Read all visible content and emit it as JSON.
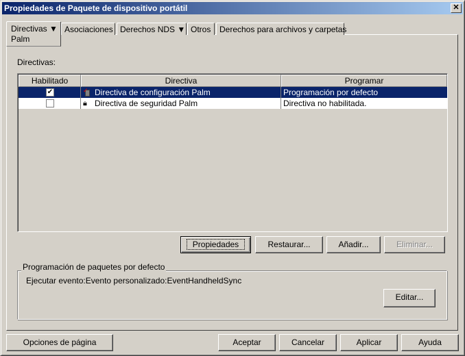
{
  "window": {
    "title": "Propiedades de Paquete de dispositivo portátil",
    "close": "✕"
  },
  "tabs": [
    {
      "label": "Directivas ▼",
      "sub": "Palm"
    },
    {
      "label": "Asociaciones"
    },
    {
      "label": "Derechos NDS ▼"
    },
    {
      "label": "Otros"
    },
    {
      "label": "Derechos para archivos y carpetas"
    }
  ],
  "section_label": "Directivas:",
  "table": {
    "columns": [
      "Habilitado",
      "Directiva",
      "Programar"
    ],
    "rows": [
      {
        "enabled": true,
        "name": "Directiva de configuración Palm",
        "schedule": "Programación por defecto",
        "selected": true
      },
      {
        "enabled": false,
        "name": "Directiva de seguridad Palm",
        "schedule": "Directiva no habilitada.",
        "selected": false
      }
    ]
  },
  "buttons": {
    "properties": "Propiedades",
    "restore": "Restaurar...",
    "add": "Añadir...",
    "remove": "Eliminar...",
    "edit": "Editar..."
  },
  "group": {
    "title": "Programación de paquetes por defecto",
    "text": "Ejecutar evento:Evento personalizado:EventHandheldSync"
  },
  "footer": {
    "page_options": "Opciones de página",
    "ok": "Aceptar",
    "cancel": "Cancelar",
    "apply": "Aplicar",
    "help": "Ayuda"
  },
  "colors": {
    "selection": "#0a246a",
    "face": "#d4d0c8"
  }
}
